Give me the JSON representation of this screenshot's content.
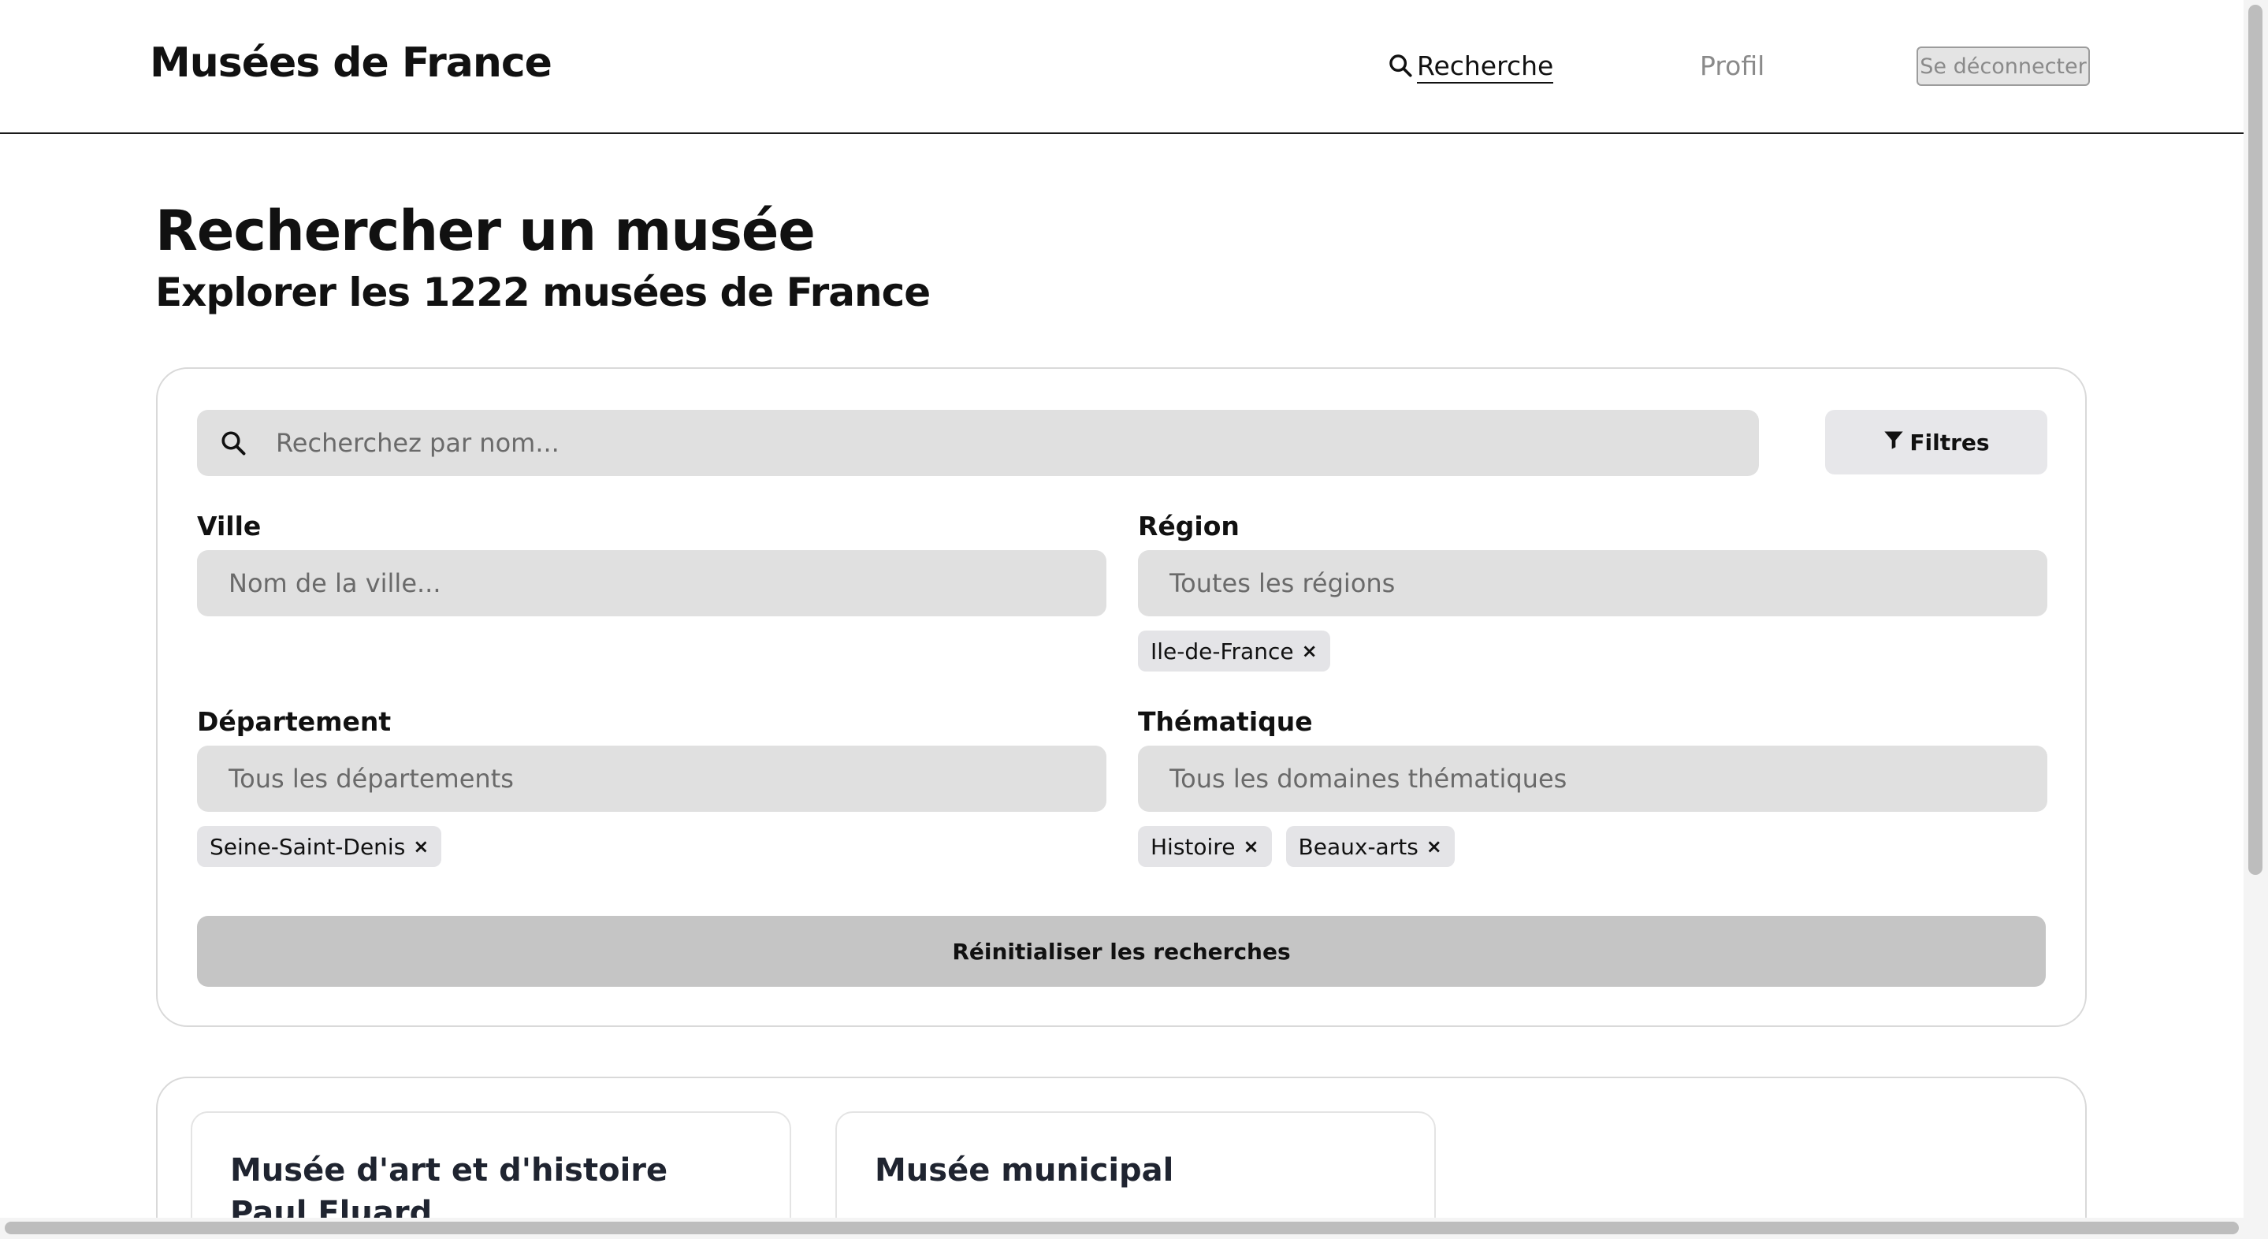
{
  "header": {
    "brand": "Musées de France",
    "nav": {
      "search_label": "Recherche",
      "profile_label": "Profil",
      "logout_label": "Se déconnecter"
    }
  },
  "main": {
    "title": "Rechercher un musée",
    "subtitle": "Explorer les 1222 musées de France"
  },
  "search": {
    "placeholder": "Recherchez par nom...",
    "filters_label": "Filtres",
    "ville": {
      "label": "Ville",
      "placeholder": "Nom de la ville..."
    },
    "region": {
      "label": "Région",
      "placeholder": "Toutes les régions",
      "selected": [
        "Ile-de-France"
      ]
    },
    "departement": {
      "label": "Département",
      "placeholder": "Tous les départements",
      "selected": [
        "Seine-Saint-Denis"
      ]
    },
    "thematique": {
      "label": "Thématique",
      "placeholder": "Tous les domaines thématiques",
      "selected": [
        "Histoire",
        "Beaux-arts"
      ]
    },
    "chip_remove": "×",
    "reset_label": "Réinitialiser les recherches"
  },
  "results": {
    "cards": [
      {
        "name": "Musée d'art et d'histoire Paul Eluard"
      },
      {
        "name": "Musée municipal"
      }
    ]
  },
  "icons": {
    "search": "search-icon",
    "filter": "filter-icon"
  }
}
